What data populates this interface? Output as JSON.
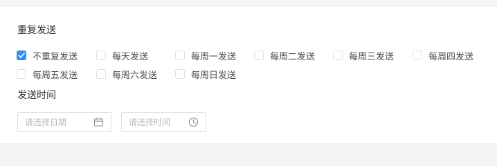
{
  "repeat": {
    "title": "重复发送",
    "options": [
      {
        "label": "不重复发送",
        "checked": true
      },
      {
        "label": "每天发送",
        "checked": false
      },
      {
        "label": "每周一发送",
        "checked": false
      },
      {
        "label": "每周二发送",
        "checked": false
      },
      {
        "label": "每周三发送",
        "checked": false
      },
      {
        "label": "每周四发送",
        "checked": false
      },
      {
        "label": "每周五发送",
        "checked": false
      },
      {
        "label": "每周六发送",
        "checked": false
      },
      {
        "label": "每周日发送",
        "checked": false
      }
    ]
  },
  "send_time": {
    "title": "发送时间",
    "date_placeholder": "请选择日期",
    "date_icon": "calendar-icon",
    "time_placeholder": "请选择时间",
    "time_icon": "clock-icon"
  },
  "colors": {
    "accent": "#2b8ff7",
    "border": "#dcdfe6",
    "background": "#f4f4f5"
  }
}
